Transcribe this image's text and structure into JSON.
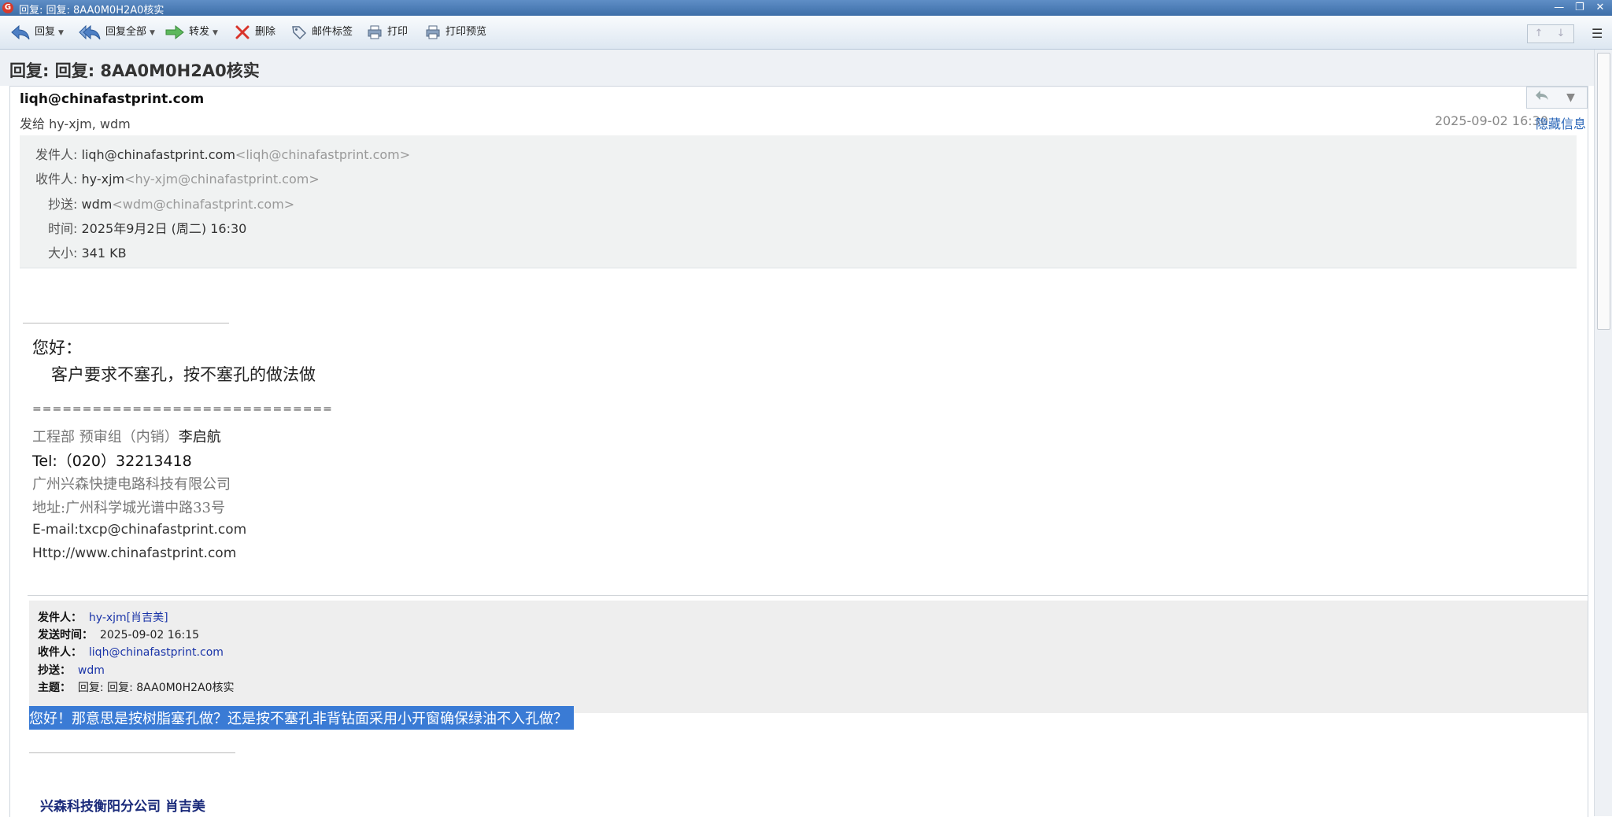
{
  "window": {
    "title": "回复: 回复: 8AA0M0H2A0核实",
    "logo_glyph": "G"
  },
  "window_controls": {
    "minimize": "—",
    "restore": "❐",
    "close": "✕"
  },
  "toolbar": {
    "reply": "回复",
    "reply_all": "回复全部",
    "forward": "转发",
    "delete": "删除",
    "tag": "邮件标签",
    "print": "打印",
    "print_preview": "打印预览",
    "nav_up": "↑",
    "nav_down": "↓",
    "menu": "☰"
  },
  "subject": "回复: 回复: 8AA0M0H2A0核实",
  "header": {
    "from": "liqh@chinafastprint.com",
    "to_line": "发给 hy-xjm, wdm",
    "date": "2025-09-02 16:30",
    "hide_info": "隐藏信息"
  },
  "details": {
    "from_label": "发件人:",
    "from_name": "liqh@chinafastprint.com",
    "from_addr": "<liqh@chinafastprint.com>",
    "to_label": "收件人:",
    "to_name": "hy-xjm",
    "to_addr": "<hy-xjm@chinafastprint.com>",
    "cc_label": "抄送:",
    "cc_name": "wdm",
    "cc_addr": "<wdm@chinafastprint.com>",
    "time_label": "时间:",
    "time_value": "2025年9月2日 (周二) 16:30",
    "size_label": "大小:",
    "size_value": "341 KB"
  },
  "body": {
    "greeting": "您好：",
    "message": "客户要求不塞孔，按不塞孔的做法做",
    "separator": "==============================",
    "sig_dept": "工程部   预审组（内销）",
    "sig_name": "李启航",
    "sig_tel": "Tel:（020）32213418",
    "sig_company": "广州兴森快捷电路科技有限公司",
    "sig_address": "地址:广州科学城光谱中路33号",
    "sig_email": "E-mail:txcp@chinafastprint.com",
    "sig_web": "Http://www.chinafastprint.com"
  },
  "quoted": {
    "from_label": "发件人：",
    "from_value": "hy-xjm[肖吉美]",
    "sent_label": "发送时间：",
    "sent_value": "2025-09-02 16:15",
    "to_label": "收件人：",
    "to_value": "liqh@chinafastprint.com",
    "cc_label": "抄送：",
    "cc_value": "wdm",
    "subject_label": "主题：",
    "subject_value": "回复: 回复: 8AA0M0H2A0核实",
    "highlighted_text": "您好！那意思是按树脂塞孔做？还是按不塞孔非背钻面采用小开窗确保绿油不入孔做？",
    "signature": "兴森科技衡阳分公司 肖吉美"
  },
  "colors": {
    "highlight": "#3a7bd5",
    "link": "#1a34a8",
    "titlebar": "#4a7cb8"
  }
}
